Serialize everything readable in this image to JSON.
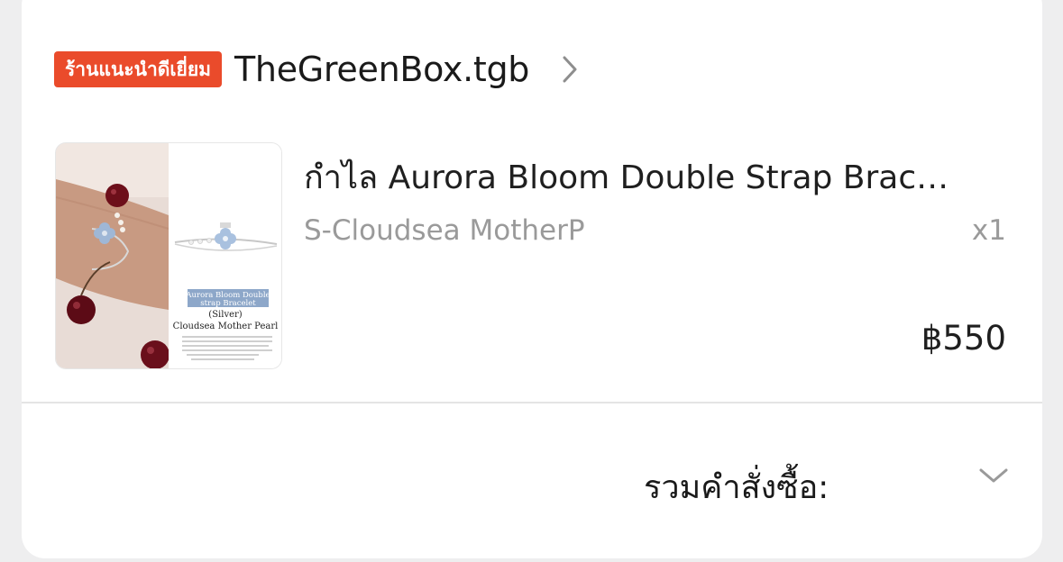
{
  "shop": {
    "badge": "ร้านแนะนำดีเยี่ยม",
    "name": "TheGreenBox.tgb",
    "chevron_icon": "chevron-right-icon"
  },
  "item": {
    "title": "กำไล Aurora Bloom Double Strap Brac…",
    "variant": "S-Cloudsea MotherP",
    "quantity": "x1",
    "price": "฿550",
    "image": {
      "caption_line1": "Aurora Bloom Double",
      "caption_line2": "strap Bracelet",
      "caption_line3": "(Silver)",
      "caption_line4": "Cloudsea Mother Pearl"
    }
  },
  "order_total": {
    "label": "รวมคำสั่งซื้อ:",
    "chevron_icon": "chevron-down-icon"
  },
  "colors": {
    "badge_bg": "#ea4b2b",
    "page_bg": "#eeeeef",
    "card_bg": "#ffffff"
  }
}
